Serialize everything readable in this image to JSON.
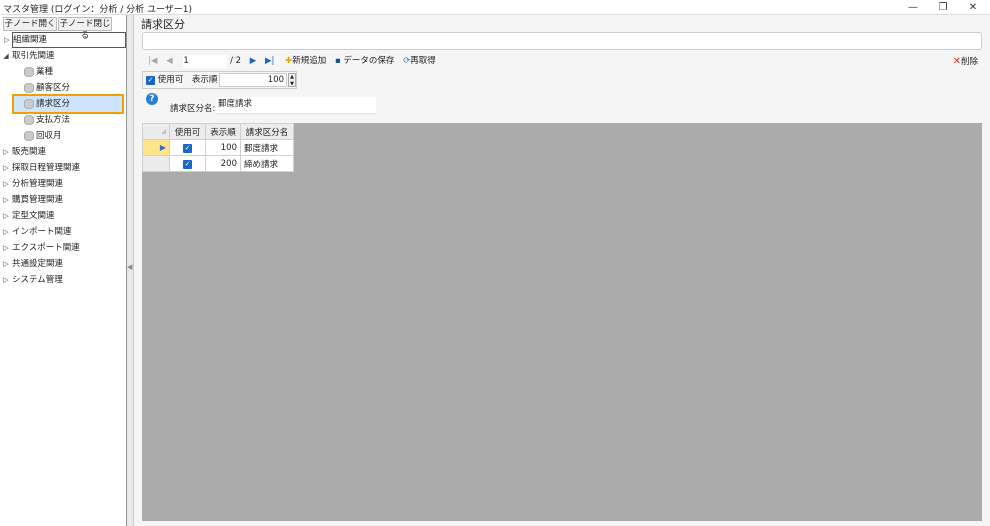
{
  "window": {
    "title": "マスタ管理 (ログイン：分析 / 分析 ユーザー1)",
    "minimize": "—",
    "restore": "❐",
    "close": "✕"
  },
  "left": {
    "expand_btn": "子ノード開く",
    "collapse_btn": "子ノード閉じる",
    "nodes": [
      {
        "label": "組織関連",
        "arrow": "▷"
      },
      {
        "label": "取引先関連",
        "arrow": "◢"
      },
      {
        "label": "業種"
      },
      {
        "label": "顧客区分"
      },
      {
        "label": "請求区分"
      },
      {
        "label": "支払方法"
      },
      {
        "label": "回収月"
      },
      {
        "label": "販売関連",
        "arrow": "▷"
      },
      {
        "label": "採取日程管理関連",
        "arrow": "▷"
      },
      {
        "label": "分析管理関連",
        "arrow": "▷"
      },
      {
        "label": "購買管理関連",
        "arrow": "▷"
      },
      {
        "label": "定型文関連",
        "arrow": "▷"
      },
      {
        "label": "インポート関連",
        "arrow": "▷"
      },
      {
        "label": "エクスポート関連",
        "arrow": "▷"
      },
      {
        "label": "共通設定関連",
        "arrow": "▷"
      },
      {
        "label": "システム管理",
        "arrow": "▷"
      }
    ]
  },
  "main": {
    "title": "請求区分",
    "search_value": "",
    "toolbar": {
      "first": "|◀",
      "prev": "◀",
      "page": "1",
      "total": "/ 2",
      "next": "▶",
      "last": "▶|",
      "add": "新規追加",
      "save": "データの保存",
      "reload": "再取得",
      "delete": "削除"
    },
    "filter": {
      "enabled_label": "使用可",
      "order_label": "表示順",
      "order_value": "100"
    },
    "help": "?",
    "name_label": "請求区分名:",
    "name_value": "郵度請求",
    "grid": {
      "columns": [
        "使用可",
        "表示順",
        "請求区分名"
      ],
      "rows": [
        {
          "order": "100",
          "name": "郵度請求",
          "check": "✓"
        },
        {
          "order": "200",
          "name": "締め請求",
          "check": "✓"
        }
      ]
    }
  }
}
